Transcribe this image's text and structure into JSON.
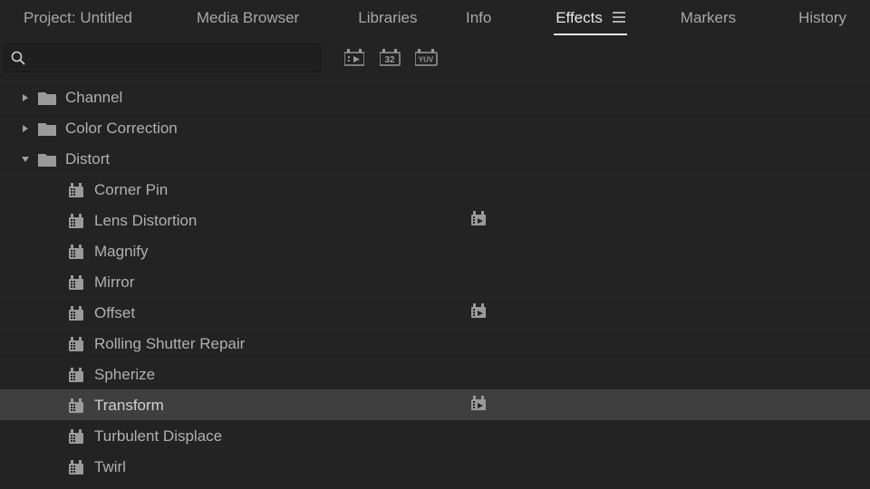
{
  "tabs": {
    "project": "Project: Untitled",
    "media_browser": "Media Browser",
    "libraries": "Libraries",
    "info": "Info",
    "effects": "Effects",
    "markers": "Markers",
    "history": "History"
  },
  "search": {
    "value": "",
    "placeholder": ""
  },
  "toolbar_icons": {
    "accel": "accelerated-effects-icon",
    "thirtytwo": "32",
    "yuv": "YUV"
  },
  "folders": [
    {
      "label": "Channel",
      "expanded": false
    },
    {
      "label": "Color Correction",
      "expanded": false
    },
    {
      "label": "Distort",
      "expanded": true
    }
  ],
  "effects": [
    {
      "label": "Corner Pin",
      "accel": false,
      "highlighted": false
    },
    {
      "label": "Lens Distortion",
      "accel": true,
      "highlighted": false
    },
    {
      "label": "Magnify",
      "accel": false,
      "highlighted": false
    },
    {
      "label": "Mirror",
      "accel": false,
      "highlighted": false
    },
    {
      "label": "Offset",
      "accel": true,
      "highlighted": false
    },
    {
      "label": "Rolling Shutter Repair",
      "accel": false,
      "highlighted": false
    },
    {
      "label": "Spherize",
      "accel": false,
      "highlighted": false
    },
    {
      "label": "Transform",
      "accel": true,
      "highlighted": true
    },
    {
      "label": "Turbulent Displace",
      "accel": false,
      "highlighted": false
    },
    {
      "label": "Twirl",
      "accel": false,
      "highlighted": false
    }
  ]
}
